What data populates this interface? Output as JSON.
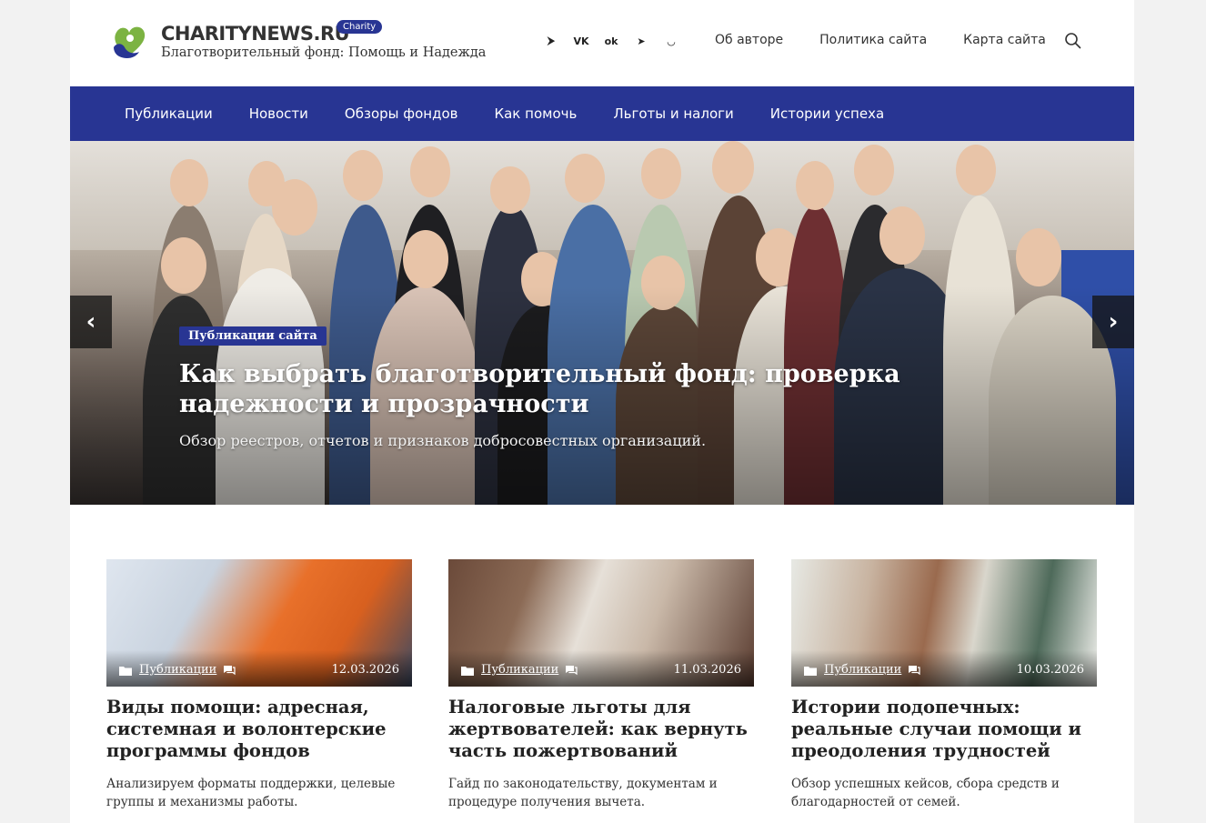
{
  "header": {
    "brand_name": "CHARITYNEWS.RU",
    "brand_badge": "Charity",
    "brand_sub": "Благотворительный фонд: Помощь и Надежда",
    "socials": [
      {
        "icon": "zen-icon",
        "glyph": "⮞"
      },
      {
        "icon": "vk-icon",
        "glyph": "VK"
      },
      {
        "icon": "odnoklassniki-icon",
        "glyph": "ok"
      },
      {
        "icon": "telegram-icon",
        "glyph": "➤"
      },
      {
        "icon": "rutube-icon",
        "glyph": "◡"
      }
    ],
    "links": [
      "Об авторе",
      "Политика сайта",
      "Карта сайта"
    ]
  },
  "nav": {
    "items": [
      "Публикации",
      "Новости",
      "Обзоры фондов",
      "Как помочь",
      "Льготы и налоги",
      "Истории успеха"
    ]
  },
  "hero": {
    "category": "Публикации сайта",
    "title": "Как выбрать благотворительный фонд: проверка надежности и прозрачности",
    "description": "Обзор реестров, отчетов и признаков добросовестных организаций.",
    "prev": "‹",
    "next": "›"
  },
  "cards": [
    {
      "category": "Публикации",
      "date": "12.03.2026",
      "title": "Виды помощи: адресная, системная и волонтерские программы фондов",
      "description": "Анализируем форматы поддержки, целевые группы и механизмы работы."
    },
    {
      "category": "Публикации",
      "date": "11.03.2026",
      "title": "Налоговые льготы для жертвователей: как вернуть часть пожертвований",
      "description": "Гайд по законодательству, документам и процедуре получения вычета."
    },
    {
      "category": "Публикации",
      "date": "10.03.2026",
      "title": "Истории подопечных: реальные случаи помощи и преодоления трудностей",
      "description": "Обзор успешных кейсов, сбора средств и благодарностей от семей."
    }
  ],
  "colors": {
    "brand": "#283593",
    "logo_green": "#7cb342",
    "logo_blue": "#283593"
  }
}
